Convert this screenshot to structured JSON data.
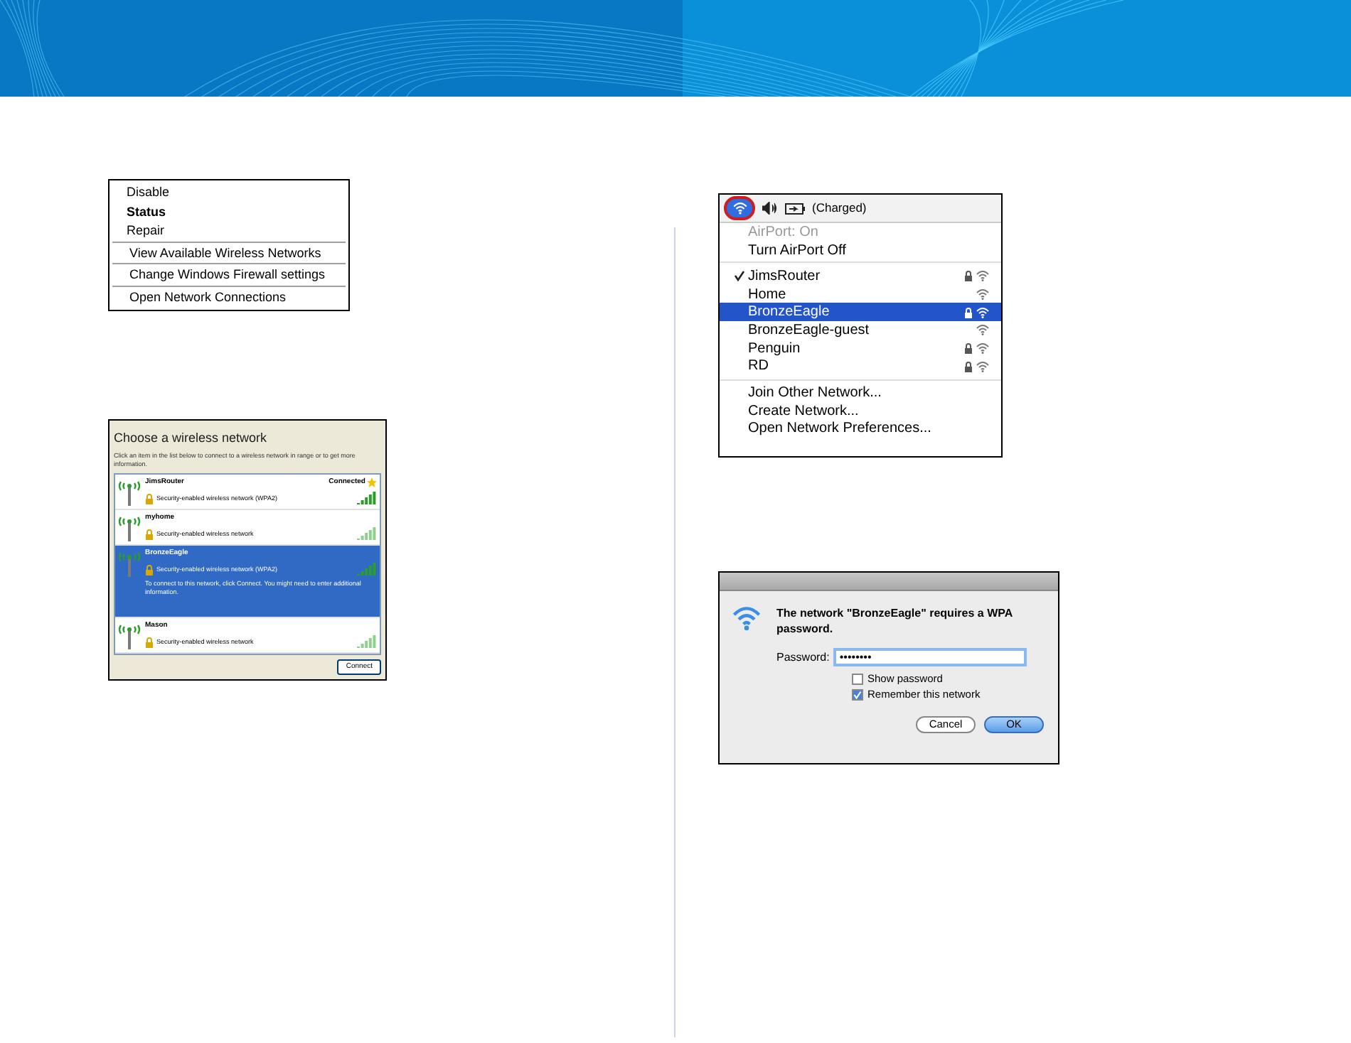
{
  "context_menu": {
    "groups": [
      [
        {
          "label": "Disable",
          "bold": false
        },
        {
          "label": "Status",
          "bold": true
        },
        {
          "label": "Repair",
          "bold": false
        }
      ],
      [
        {
          "label": "View Available Wireless Networks",
          "bold": false
        }
      ],
      [
        {
          "label": "Change Windows Firewall settings",
          "bold": false
        }
      ],
      [
        {
          "label": "Open Network Connections",
          "bold": false
        }
      ]
    ]
  },
  "wireless_dialog": {
    "title": "Choose a wireless network",
    "instructions": "Click an item in the list below to connect to a wireless network in range or to get more information.",
    "networks": [
      {
        "name": "JimsRouter",
        "status": "Connected",
        "security": "Security-enabled wireless network (WPA2)",
        "selected": false
      },
      {
        "name": "myhome",
        "security": "Security-enabled wireless network",
        "selected": false
      },
      {
        "name": "BronzeEagle",
        "security": "Security-enabled wireless network (WPA2)",
        "details": "To connect to this network, click Connect. You might need to enter additional information.",
        "selected": true
      },
      {
        "name": "Mason",
        "security": "Security-enabled wireless network",
        "selected": false
      }
    ],
    "button": "Connect"
  },
  "airport_menu": {
    "battery_status": "(Charged)",
    "header_items": [
      {
        "label": "AirPort: On",
        "disabled": true
      },
      {
        "label": "Turn AirPort Off",
        "disabled": false
      }
    ],
    "networks": [
      {
        "name": "JimsRouter",
        "checked": true,
        "selected": false,
        "locked": true
      },
      {
        "name": "Home",
        "checked": false,
        "selected": false,
        "locked": false
      },
      {
        "name": "BronzeEagle",
        "checked": false,
        "selected": true,
        "locked": true
      },
      {
        "name": "BronzeEagle-guest",
        "checked": false,
        "selected": false,
        "locked": false
      },
      {
        "name": "Penguin",
        "checked": false,
        "selected": false,
        "locked": true
      },
      {
        "name": "RD",
        "checked": false,
        "selected": false,
        "locked": true
      }
    ],
    "actions": [
      "Join Other Network...",
      "Create Network...",
      "Open Network Preferences..."
    ]
  },
  "password_dialog": {
    "message": "The network \"BronzeEagle\" requires a WPA password.",
    "password_label": "Password:",
    "password_value": "••••••••",
    "options": [
      {
        "label": "Show password",
        "checked": false
      },
      {
        "label": "Remember this network",
        "checked": true
      }
    ],
    "buttons": [
      {
        "label": "Cancel",
        "kind": "secondary"
      },
      {
        "label": "OK",
        "kind": "default"
      }
    ]
  }
}
